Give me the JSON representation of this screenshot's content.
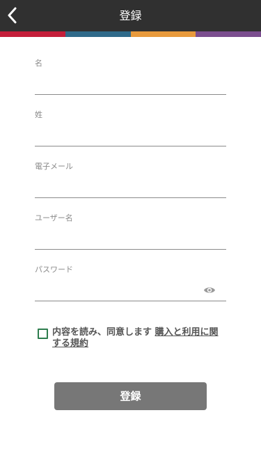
{
  "header": {
    "title": "登録"
  },
  "stripe_colors": [
    "#c41e3a",
    "#2f6a8a",
    "#e89a3c",
    "#7b4e8f"
  ],
  "form": {
    "first_name": {
      "label": "名",
      "value": ""
    },
    "last_name": {
      "label": "姓",
      "value": ""
    },
    "email": {
      "label": "電子メール",
      "value": ""
    },
    "username": {
      "label": "ユーザー名",
      "value": ""
    },
    "password": {
      "label": "パスワード",
      "value": "",
      "visibility_icon": "eye-icon"
    }
  },
  "terms": {
    "checked": false,
    "text": "内容を読み、同意します",
    "link_text": "購入と利用に関する規約"
  },
  "actions": {
    "register_label": "登録"
  },
  "colors": {
    "header_bg": "#303030",
    "checkbox_border": "#2e7d4e",
    "button_bg": "#777777"
  }
}
